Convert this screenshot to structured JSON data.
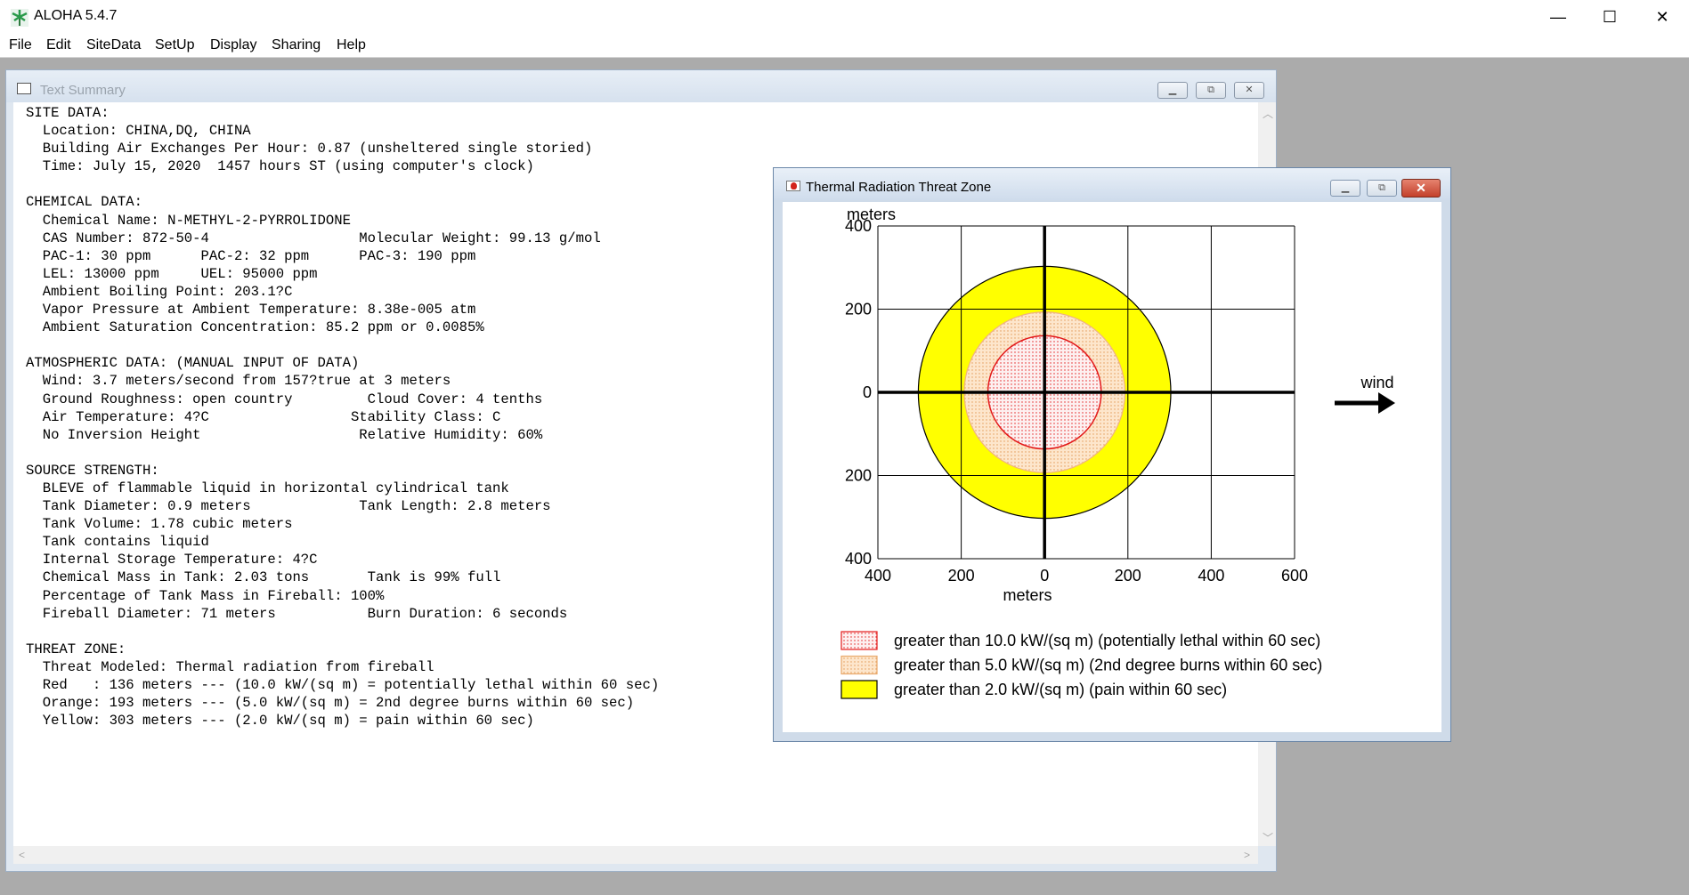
{
  "app": {
    "title": "ALOHA 5.4.7",
    "controls": {
      "minimize": "—",
      "maximize": "☐",
      "close": "✕"
    }
  },
  "menu": [
    "File",
    "Edit",
    "SiteData",
    "SetUp",
    "Display",
    "Sharing",
    "Help"
  ],
  "text_summary": {
    "title": "Text Summary",
    "lines": [
      "SITE DATA:",
      "  Location: CHINA,DQ, CHINA",
      "  Building Air Exchanges Per Hour: 0.87 (unsheltered single storied)",
      "  Time: July 15, 2020  1457 hours ST (using computer's clock)",
      "",
      "CHEMICAL DATA:",
      "  Chemical Name: N-METHYL-2-PYRROLIDONE",
      "  CAS Number: 872-50-4                  Molecular Weight: 99.13 g/mol",
      "  PAC-1: 30 ppm      PAC-2: 32 ppm      PAC-3: 190 ppm",
      "  LEL: 13000 ppm     UEL: 95000 ppm",
      "  Ambient Boiling Point: 203.1?C",
      "  Vapor Pressure at Ambient Temperature: 8.38e-005 atm",
      "  Ambient Saturation Concentration: 85.2 ppm or 0.0085%",
      "",
      "ATMOSPHERIC DATA: (MANUAL INPUT OF DATA)",
      "  Wind: 3.7 meters/second from 157?true at 3 meters",
      "  Ground Roughness: open country         Cloud Cover: 4 tenths",
      "  Air Temperature: 4?C                 Stability Class: C",
      "  No Inversion Height                   Relative Humidity: 60%",
      "",
      "SOURCE STRENGTH:",
      "  BLEVE of flammable liquid in horizontal cylindrical tank",
      "  Tank Diameter: 0.9 meters             Tank Length: 2.8 meters",
      "  Tank Volume: 1.78 cubic meters",
      "  Tank contains liquid",
      "  Internal Storage Temperature: 4?C",
      "  Chemical Mass in Tank: 2.03 tons       Tank is 99% full",
      "  Percentage of Tank Mass in Fireball: 100%",
      "  Fireball Diameter: 71 meters           Burn Duration: 6 seconds",
      "",
      "THREAT ZONE:",
      "  Threat Modeled: Thermal radiation from fireball",
      "  Red   : 136 meters --- (10.0 kW/(sq m) = potentially lethal within 60 sec)",
      "  Orange: 193 meters --- (5.0 kW/(sq m) = 2nd degree burns within 60 sec)",
      "  Yellow: 303 meters --- (2.0 kW/(sq m) = pain within 60 sec)"
    ]
  },
  "threat_window": {
    "title": "Thermal Radiation Threat Zone",
    "wind_label": "wind",
    "legend": [
      {
        "label": "greater than 10.0 kW/(sq m) (potentially lethal within 60 sec)",
        "fill": "#fbe4e4",
        "stroke": "#e31b1b"
      },
      {
        "label": "greater than 5.0 kW/(sq m) (2nd degree burns within 60 sec)",
        "fill": "#fbe0c2",
        "stroke": "#e8a86a"
      },
      {
        "label": "greater than 2.0 kW/(sq m) (pain within 60 sec)",
        "fill": "#ffff00",
        "stroke": "#000000"
      }
    ]
  },
  "chart_data": {
    "type": "threat-zone-plot",
    "xlabel": "meters",
    "ylabel": "meters",
    "xlim": [
      -400,
      600
    ],
    "ylim": [
      -400,
      400
    ],
    "x_ticks": [
      -400,
      -200,
      0,
      200,
      400,
      600
    ],
    "x_tick_labels": [
      "400",
      "200",
      "0",
      "200",
      "400",
      "600"
    ],
    "y_ticks": [
      400,
      200,
      0,
      -200,
      -400
    ],
    "y_tick_labels": [
      "400",
      "200",
      "0",
      "200",
      "400"
    ],
    "grid": true,
    "zones": [
      {
        "name": "Yellow",
        "radius": 303,
        "color": "#ffff00"
      },
      {
        "name": "Orange",
        "radius": 193,
        "color": "#fbe0c2"
      },
      {
        "name": "Red",
        "radius": 136,
        "color": "#fbe4e4"
      }
    ]
  }
}
